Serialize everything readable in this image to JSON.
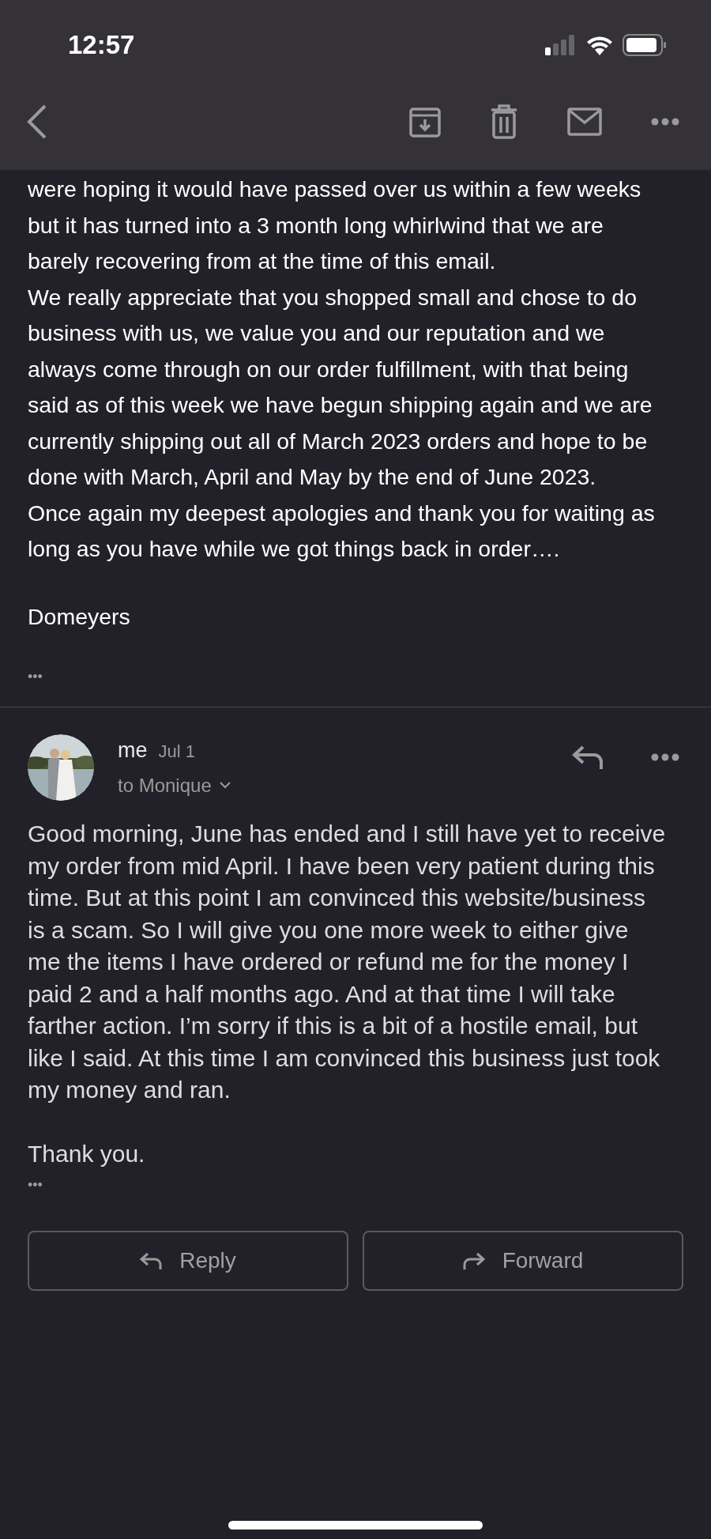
{
  "status_bar": {
    "time": "12:57"
  },
  "messages": [
    {
      "kind": "continued",
      "paragraphs": [
        "were hoping it would have passed over us within a few weeks but it has turned into a 3 month long whirlwind that we are barely recovering from at the time of this email.",
        "We really appreciate that you shopped small and chose to do business with us, we value you and our reputation and we always come through on our order fulfillment, with that being said as of this week we have begun shipping again and we are currently shipping out all of March 2023 orders and hope to be done with March, April and May by the end of June 2023.",
        "Once again my deepest apologies and thank you for waiting as long as you have while we got things back in order…."
      ],
      "signature": "Domeyers",
      "more": "•••"
    },
    {
      "kind": "full",
      "sender": "me",
      "date": "Jul 1",
      "recipient": "to Monique",
      "paragraphs": [
        "Good morning, June has ended and I still have yet to receive my order from mid April. I have been very patient during this time. But at this point I am convinced this website/business is a scam. So I will give you one more week to either give me the items I have ordered or refund me for the money I paid 2 and a half months ago. And at that time I will take farther action. I’m sorry if this is a bit of a hostile email, but like I said. At this time I am convinced this business just took my money and ran."
      ],
      "signature": "Thank you.",
      "more": "•••"
    }
  ],
  "actions": [
    {
      "kind": "reply",
      "label": "Reply"
    },
    {
      "kind": "forward",
      "label": "Forward"
    }
  ]
}
